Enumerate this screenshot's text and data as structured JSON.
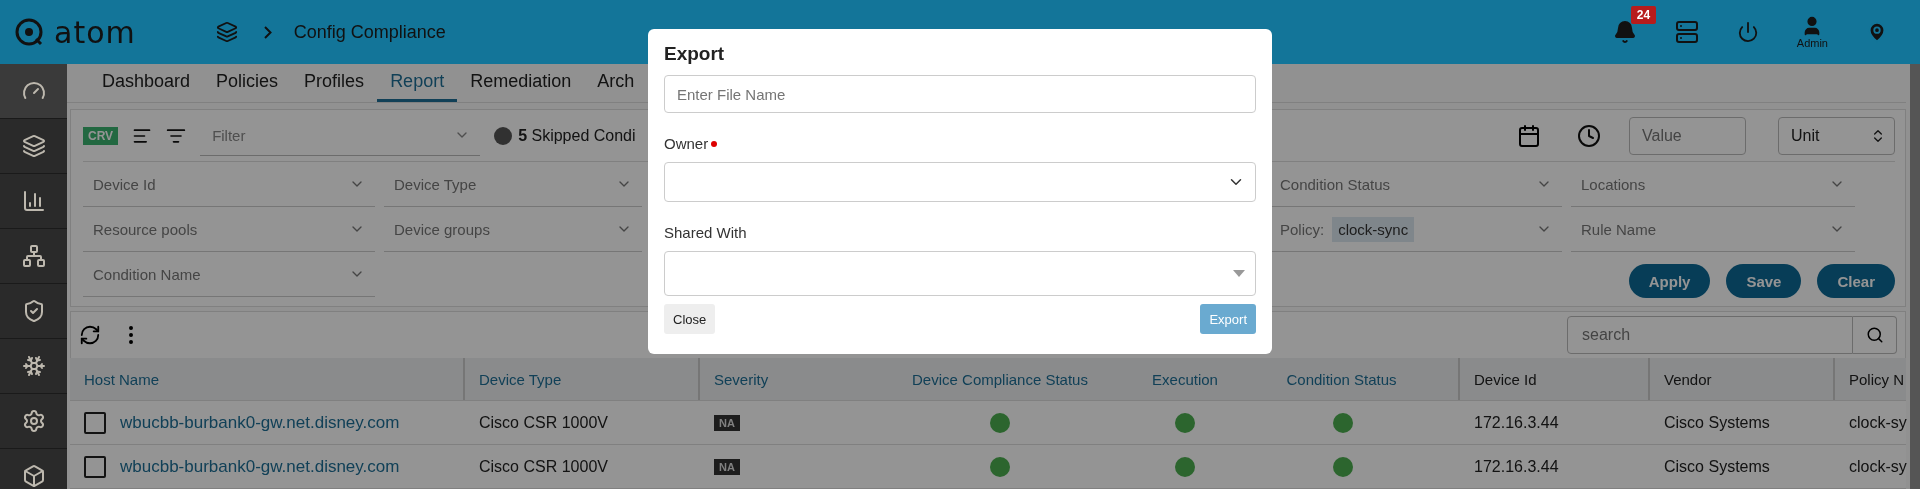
{
  "header": {
    "logo": "atom",
    "breadcrumb": "Config Compliance",
    "notifications": "24",
    "user": "Admin"
  },
  "sidebar": {
    "items": [
      {
        "kind": "gauge",
        "selected": true
      },
      {
        "kind": "cards",
        "selected": false
      },
      {
        "kind": "bars",
        "selected": false
      },
      {
        "kind": "nodes",
        "selected": false
      },
      {
        "kind": "shield",
        "selected": false
      },
      {
        "kind": "snowflake",
        "selected": false
      },
      {
        "kind": "gear",
        "selected": false
      },
      {
        "kind": "cube",
        "selected": false
      }
    ]
  },
  "tabs": [
    {
      "label": "Dashboard",
      "selected": false
    },
    {
      "label": "Policies",
      "selected": false
    },
    {
      "label": "Profiles",
      "selected": false
    },
    {
      "label": "Report",
      "selected": true
    },
    {
      "label": "Remediation",
      "selected": false
    },
    {
      "label": "Arch",
      "selected": false
    }
  ],
  "filter_bar": {
    "badge": "CRV",
    "filter": {
      "placeholder": "Filter"
    },
    "skipped": "**5** Skipped Condi",
    "value": {
      "placeholder": "Value"
    },
    "unit": "Unit"
  },
  "filters_left": [
    [
      "Device Id",
      "Device Type"
    ],
    [
      "Resource pools",
      "Device groups"
    ],
    [
      "Condition Name"
    ]
  ],
  "filters_right": [
    {
      "kind": "select",
      "label": "Condition Status"
    },
    {
      "kind": "select",
      "label": "Locations"
    },
    {
      "kind": "chip",
      "label": "Policy:",
      "chip": "clock-sync"
    },
    {
      "kind": "select",
      "label": "Rule Name"
    }
  ],
  "actions": [
    "Apply",
    "Save",
    "Clear"
  ],
  "search": {
    "placeholder": "search"
  },
  "table": {
    "columns": [
      "Host Name",
      "Device Type",
      "Severity",
      "Device Compliance Status",
      "Execution",
      "Condition Status",
      "Device Id",
      "Vendor",
      "Policy N"
    ],
    "rows": [
      {
        "checked": false,
        "host": "wbucbb-burbank0-gw.net.disney.com",
        "type": "Cisco CSR 1000V",
        "severity": "NA",
        "compliance_ok": true,
        "execution_ok": true,
        "condition_ok": true,
        "device_id": "172.16.3.44",
        "vendor": "Cisco Systems",
        "policy": "clock-sy"
      },
      {
        "checked": false,
        "host": "wbucbb-burbank0-gw.net.disney.com",
        "type": "Cisco CSR 1000V",
        "severity": "NA",
        "compliance_ok": true,
        "execution_ok": true,
        "condition_ok": true,
        "device_id": "172.16.3.44",
        "vendor": "Cisco Systems",
        "policy": "clock-sy"
      }
    ]
  },
  "dialog": {
    "title": "Export",
    "file_name": {
      "placeholder": "Enter File Name"
    },
    "owner_label": "Owner",
    "owner_required": true,
    "shared_label": "Shared With",
    "close": "Close",
    "export": "Export",
    "export_disabled": true
  }
}
